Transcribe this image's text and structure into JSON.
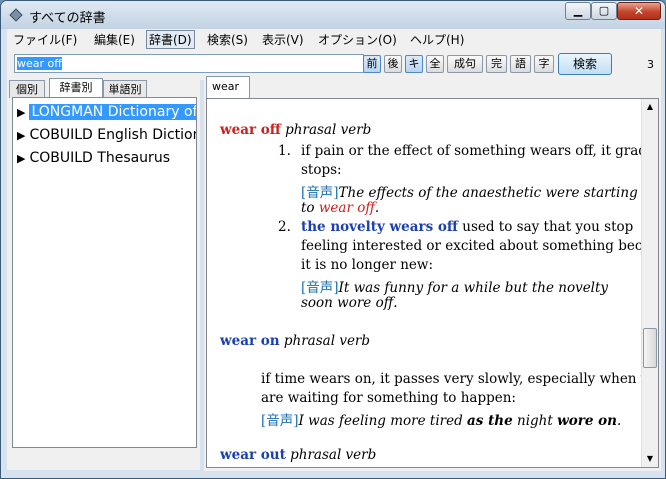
{
  "window": {
    "title": "すべての辞書"
  },
  "menu": [
    "ファイル(F)",
    "編集(E)",
    "辞書(D)",
    "検索(S)",
    "表示(V)",
    "オプション(O)",
    "ヘルプ(H)"
  ],
  "toolbar": {
    "search_value": "wear off",
    "buttons": [
      "前",
      "後",
      "キ",
      "全",
      "成句",
      "完",
      "語",
      "字"
    ],
    "search_button": "検索",
    "result_count": "3"
  },
  "left_tabs": [
    "個別",
    "辞書別",
    "単語別"
  ],
  "dictionaries": [
    "LONGMAN Dictionary of",
    "COBUILD English Dictionary",
    "COBUILD Thesaurus"
  ],
  "result_tab": "wear",
  "entry": {
    "hw1": "wear off",
    "pos1": "phrasal verb",
    "s1_num": "1.",
    "s1_l1": "if pain or the effect of something wears off, it gradually",
    "s1_l2": "stops:",
    "snd": "[音声]",
    "s1_ex1": "The effects of the anaesthetic were starting",
    "s1_ex2a": "to ",
    "s1_ex2b": "wear off",
    "s1_ex2c": ".",
    "s2_num": "2.",
    "s2_phrase": "the novelty wears off",
    "s2_l1": " used to say that you stop",
    "s2_l2": "feeling interested or excited about something because",
    "s2_l3": "it is no longer new:",
    "s2_ex1": "It was funny for a while but the novelty",
    "s2_ex2": "soon wore off.",
    "hw2": "wear on",
    "pos2": "phrasal verb",
    "w2_l1": "if time wears on, it passes very slowly, especially when you",
    "w2_l2": "are waiting for something to happen:",
    "w2_ex_a": "I was feeling more tired ",
    "w2_ex_b": "as the",
    "w2_ex_c": " night ",
    "w2_ex_d": "wore on",
    "w2_ex_e": ".",
    "hw3": "wear out",
    "pos3": "phrasal verb"
  }
}
